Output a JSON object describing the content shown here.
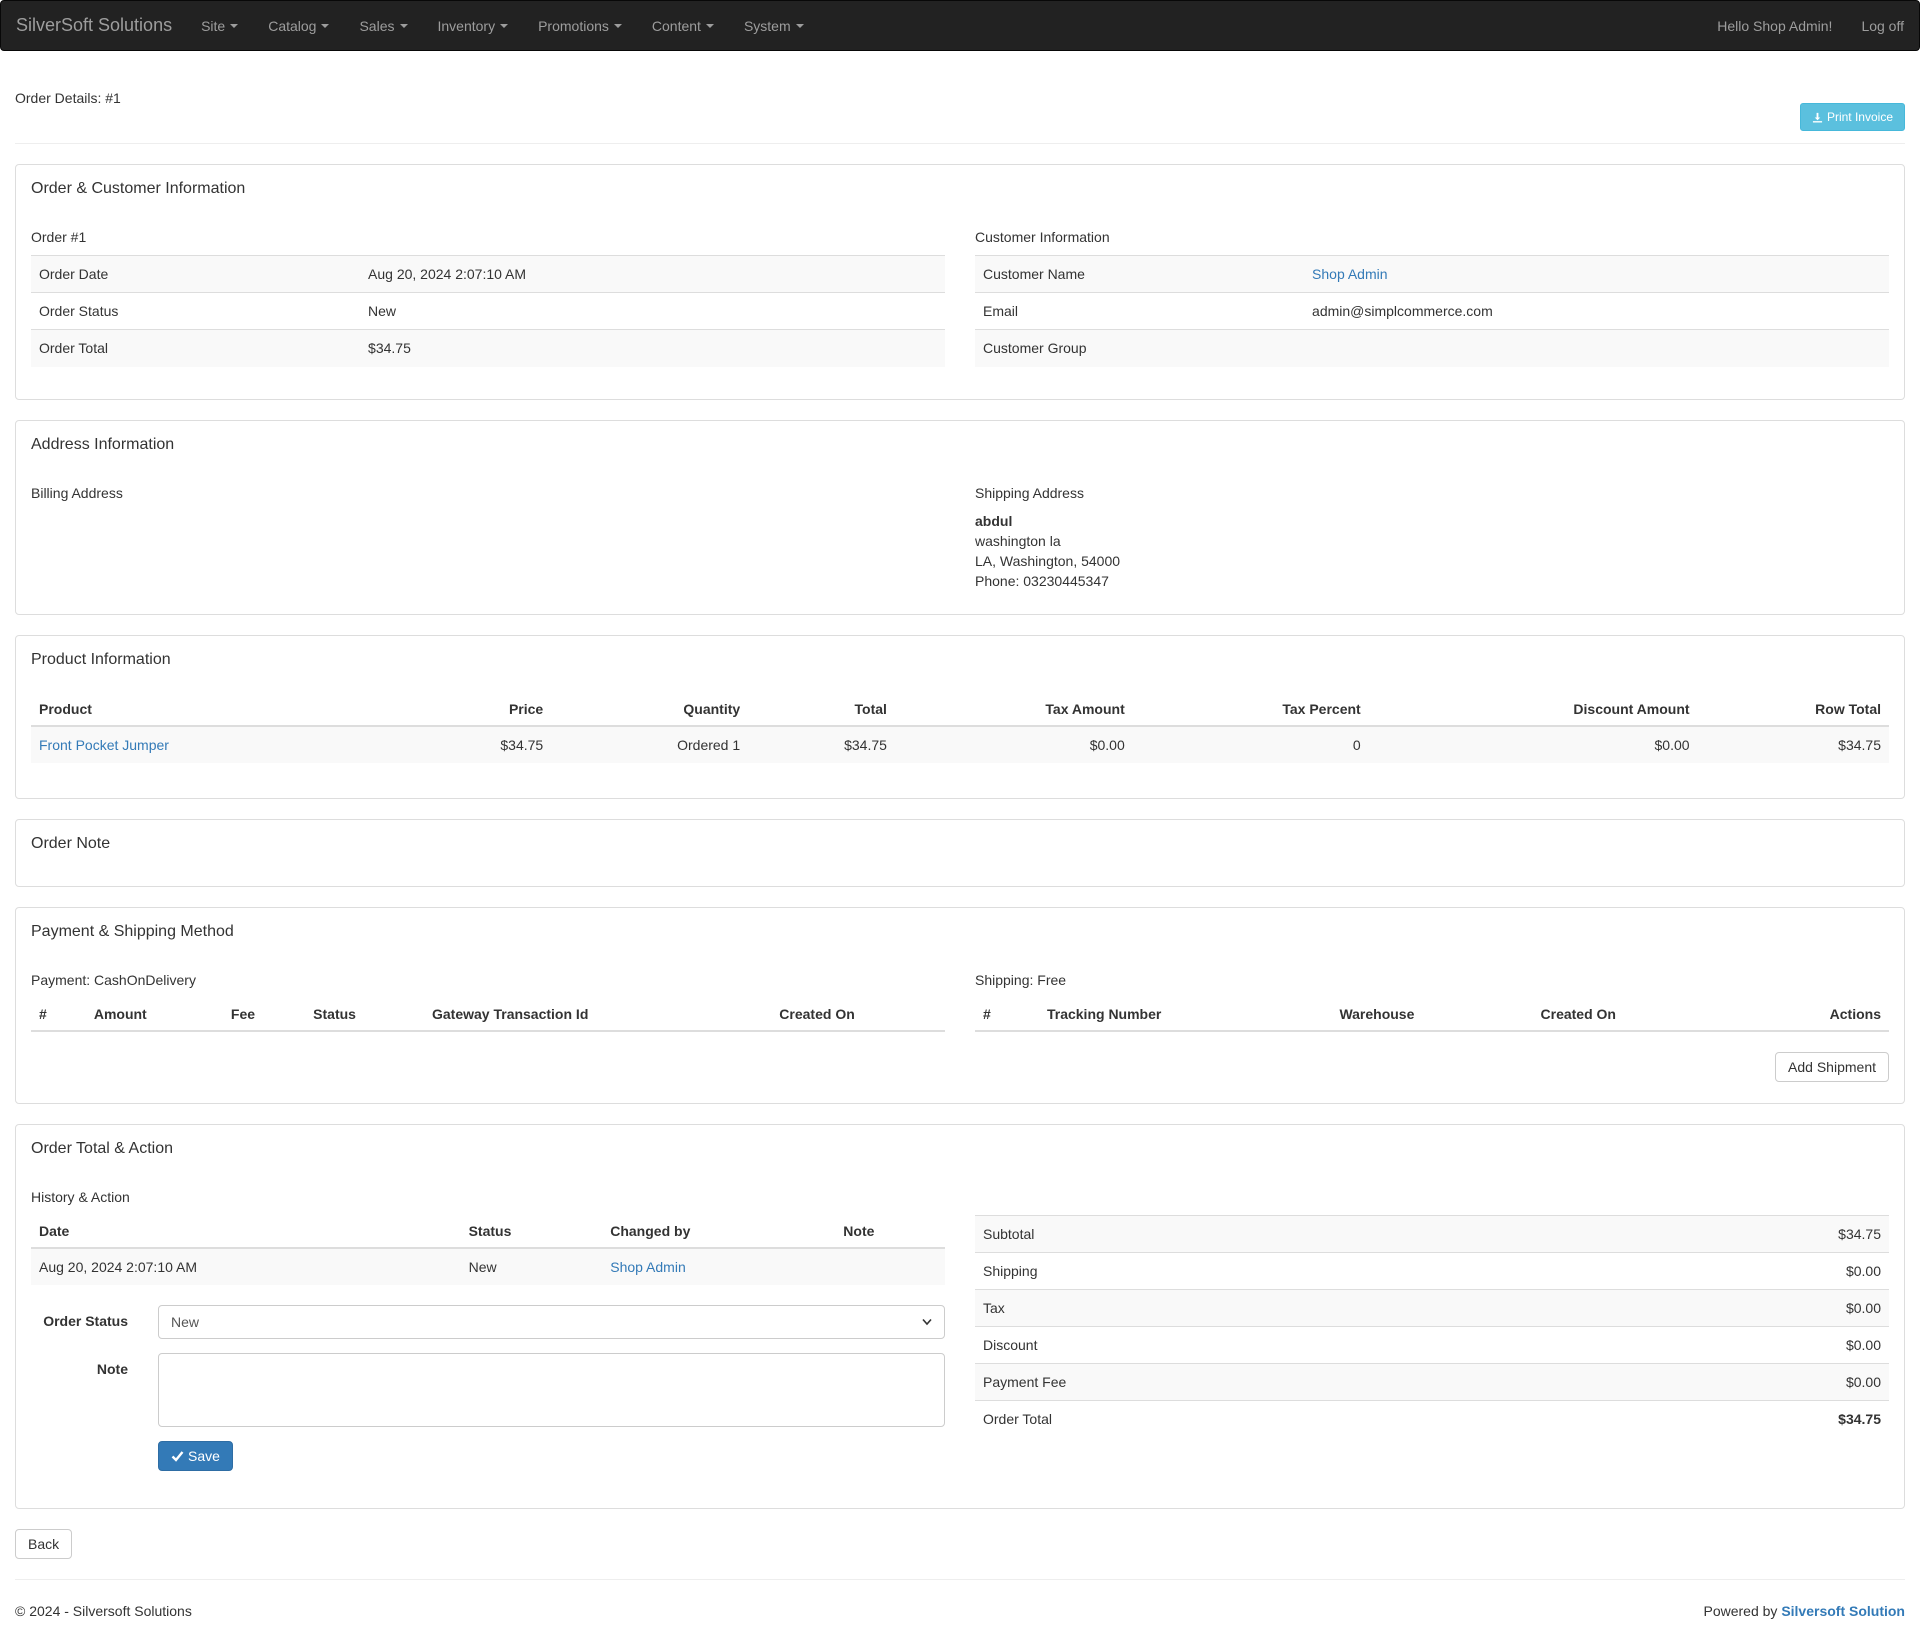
{
  "navbar": {
    "brand": "SilverSoft Solutions",
    "menus": [
      "Site",
      "Catalog",
      "Sales",
      "Inventory",
      "Promotions",
      "Content",
      "System"
    ],
    "greeting": "Hello Shop Admin!",
    "logoff": "Log off"
  },
  "header": {
    "title": "Order Details: #1",
    "print_invoice": "Print Invoice"
  },
  "order_customer": {
    "title": "Order & Customer Information",
    "order_heading": "Order #1",
    "order_rows": [
      {
        "label": "Order Date",
        "value": "Aug 20, 2024 2:07:10 AM"
      },
      {
        "label": "Order Status",
        "value": "New"
      },
      {
        "label": "Order Total",
        "value": "$34.75"
      }
    ],
    "customer_heading": "Customer Information",
    "customer_rows": [
      {
        "label": "Customer Name",
        "value": "Shop Admin"
      },
      {
        "label": "Email",
        "value": "admin@simplcommerce.com"
      },
      {
        "label": "Customer Group",
        "value": ""
      }
    ]
  },
  "address": {
    "title": "Address Information",
    "billing_heading": "Billing Address",
    "shipping_heading": "Shipping Address",
    "shipping_name": "abdul",
    "shipping_lines": [
      "washington la",
      "LA, Washington, 54000",
      "Phone: 03230445347"
    ]
  },
  "products": {
    "title": "Product Information",
    "columns": [
      "Product",
      "Price",
      "Quantity",
      "Total",
      "Tax Amount",
      "Tax Percent",
      "Discount Amount",
      "Row Total"
    ],
    "rows": [
      [
        "Front Pocket Jumper",
        "$34.75",
        "Ordered 1",
        "$34.75",
        "$0.00",
        "0",
        "$0.00",
        "$34.75"
      ]
    ]
  },
  "order_note": {
    "title": "Order Note"
  },
  "payment_shipping": {
    "title": "Payment & Shipping Method",
    "payment_heading": "Payment: CashOnDelivery",
    "payment_columns": [
      "#",
      "Amount",
      "Fee",
      "Status",
      "Gateway Transaction Id",
      "Created On"
    ],
    "shipping_heading": "Shipping: Free",
    "shipping_columns": [
      "#",
      "Tracking Number",
      "Warehouse",
      "Created On",
      "Actions"
    ],
    "add_shipment": "Add Shipment"
  },
  "order_total": {
    "title": "Order Total & Action",
    "history_heading": "History & Action",
    "history_columns": [
      "Date",
      "Status",
      "Changed by",
      "Note"
    ],
    "history_rows": [
      {
        "date": "Aug 20, 2024 2:07:10 AM",
        "status": "New",
        "changed_by": "Shop Admin",
        "note": ""
      }
    ],
    "status_label": "Order Status",
    "status_value": "New",
    "note_label": "Note",
    "save": "Save",
    "totals": [
      {
        "label": "Subtotal",
        "value": "$34.75"
      },
      {
        "label": "Shipping",
        "value": "$0.00"
      },
      {
        "label": "Tax",
        "value": "$0.00"
      },
      {
        "label": "Discount",
        "value": "$0.00"
      },
      {
        "label": "Payment Fee",
        "value": "$0.00"
      },
      {
        "label": "Order Total",
        "value": "$34.75"
      }
    ]
  },
  "back": "Back",
  "footer": {
    "copyright": "© 2024 - Silversoft Solutions",
    "powered_by": "Powered by",
    "powered_link": "Silversoft Solution"
  }
}
